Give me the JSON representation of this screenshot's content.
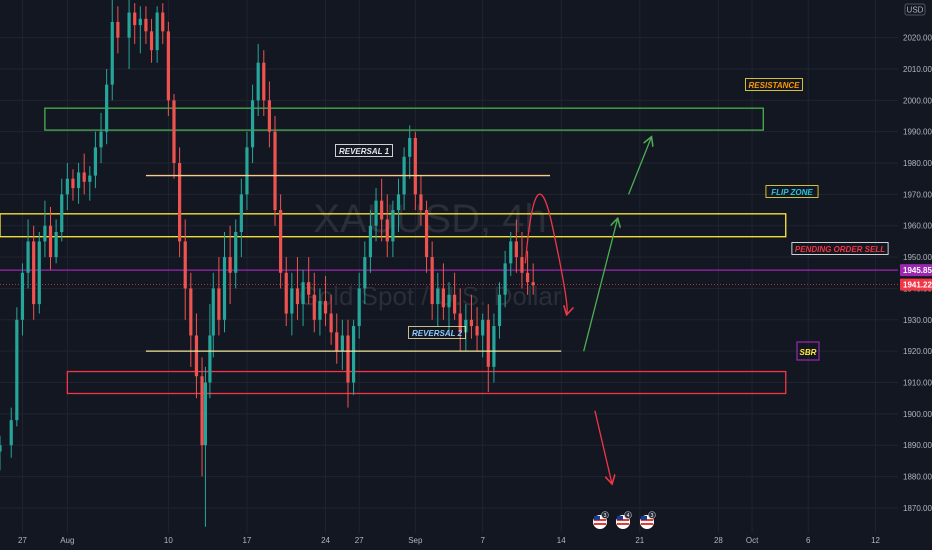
{
  "chart_data": {
    "type": "candlestick",
    "symbol_watermark": "XAUUSD, 4h",
    "symbol_watermark_sub": "Gold Spot / U.S. Dollar",
    "currency": "USD",
    "ylim": [
      1862,
      2032
    ],
    "y_ticks": [
      1870,
      1880,
      1890,
      1900,
      1910,
      1920,
      1930,
      1940,
      1950,
      1960,
      1970,
      1980,
      1990,
      2000,
      2010,
      2020
    ],
    "y_tick_labels": [
      "1870.00",
      "1880.00",
      "1890.00",
      "1900.00",
      "1910.00",
      "1920.00",
      "1930.00",
      "1940.00",
      "1950.00",
      "1960.00",
      "1970.00",
      "1980.00",
      "1990.00",
      "2000.00",
      "2010.00",
      "2020.00"
    ],
    "x_range_days": [
      -6,
      74
    ],
    "x_ticks": [
      {
        "day": -4,
        "label": "27"
      },
      {
        "day": 0,
        "label": "Aug"
      },
      {
        "day": 9,
        "label": "10"
      },
      {
        "day": 16,
        "label": "17"
      },
      {
        "day": 23,
        "label": "24"
      },
      {
        "day": 26,
        "label": "27"
      },
      {
        "day": 31,
        "label": "Sep"
      },
      {
        "day": 37,
        "label": "7"
      },
      {
        "day": 44,
        "label": "14"
      },
      {
        "day": 51,
        "label": "21"
      },
      {
        "day": 58,
        "label": "28"
      },
      {
        "day": 61,
        "label": "Oct"
      },
      {
        "day": 66,
        "label": "6"
      },
      {
        "day": 72,
        "label": "12"
      }
    ],
    "candles": [
      [
        -6,
        1888,
        1893,
        1882,
        1890
      ],
      [
        -5,
        1890,
        1902,
        1886,
        1898
      ],
      [
        -4.5,
        1898,
        1934,
        1896,
        1930
      ],
      [
        -4,
        1930,
        1948,
        1925,
        1945
      ],
      [
        -3.5,
        1945,
        1962,
        1940,
        1955
      ],
      [
        -3,
        1955,
        1960,
        1930,
        1935
      ],
      [
        -2.5,
        1935,
        1958,
        1932,
        1955
      ],
      [
        -2,
        1955,
        1968,
        1950,
        1960
      ],
      [
        -1.5,
        1960,
        1966,
        1946,
        1950
      ],
      [
        -1,
        1950,
        1962,
        1948,
        1958
      ],
      [
        -0.5,
        1958,
        1975,
        1955,
        1970
      ],
      [
        0,
        1970,
        1980,
        1965,
        1975
      ],
      [
        0.5,
        1975,
        1978,
        1968,
        1972
      ],
      [
        1,
        1972,
        1980,
        1967,
        1977
      ],
      [
        1.5,
        1977,
        1983,
        1970,
        1974
      ],
      [
        2,
        1974,
        1979,
        1968,
        1976
      ],
      [
        2.5,
        1976,
        1990,
        1972,
        1985
      ],
      [
        3,
        1985,
        1996,
        1980,
        1990
      ],
      [
        3.5,
        1990,
        2010,
        1986,
        2005
      ],
      [
        4,
        2005,
        2032,
        2000,
        2025
      ],
      [
        4.5,
        2025,
        2030,
        2015,
        2020
      ],
      [
        5.5,
        2020,
        2032,
        2010,
        2028
      ],
      [
        6,
        2028,
        2031,
        2018,
        2024
      ],
      [
        6.5,
        2024,
        2030,
        2015,
        2026
      ],
      [
        7,
        2026,
        2030,
        2018,
        2022
      ],
      [
        7.5,
        2022,
        2026,
        2012,
        2016
      ],
      [
        8,
        2016,
        2030,
        2012,
        2028
      ],
      [
        8.5,
        2028,
        2031,
        2018,
        2022
      ],
      [
        9,
        2022,
        2025,
        1995,
        2000
      ],
      [
        9.5,
        2000,
        2002,
        1975,
        1980
      ],
      [
        10,
        1980,
        1985,
        1950,
        1955
      ],
      [
        10.5,
        1955,
        1962,
        1930,
        1940
      ],
      [
        11,
        1940,
        1945,
        1915,
        1925
      ],
      [
        11.5,
        1925,
        1932,
        1905,
        1912
      ],
      [
        12,
        1912,
        1918,
        1880,
        1890
      ],
      [
        12.3,
        1890,
        1915,
        1864,
        1910
      ],
      [
        12.7,
        1910,
        1935,
        1905,
        1925
      ],
      [
        13,
        1925,
        1945,
        1918,
        1940
      ],
      [
        13.5,
        1940,
        1950,
        1925,
        1930
      ],
      [
        14,
        1930,
        1958,
        1926,
        1950
      ],
      [
        14.5,
        1950,
        1960,
        1935,
        1945
      ],
      [
        15,
        1945,
        1962,
        1940,
        1958
      ],
      [
        15.5,
        1958,
        1975,
        1950,
        1970
      ],
      [
        16,
        1970,
        1990,
        1965,
        1985
      ],
      [
        16.5,
        1985,
        2005,
        1980,
        2000
      ],
      [
        17,
        2000,
        2018,
        1995,
        2012
      ],
      [
        17.5,
        2012,
        2016,
        1995,
        2000
      ],
      [
        18,
        2000,
        2006,
        1985,
        1990
      ],
      [
        18.5,
        1990,
        1995,
        1960,
        1965
      ],
      [
        19,
        1965,
        1970,
        1940,
        1945
      ],
      [
        19.5,
        1945,
        1950,
        1928,
        1932
      ],
      [
        20,
        1932,
        1945,
        1925,
        1940
      ],
      [
        20.5,
        1940,
        1950,
        1930,
        1935
      ],
      [
        21,
        1935,
        1946,
        1928,
        1942
      ],
      [
        21.5,
        1942,
        1950,
        1935,
        1938
      ],
      [
        22,
        1938,
        1945,
        1926,
        1930
      ],
      [
        22.5,
        1930,
        1940,
        1925,
        1936
      ],
      [
        23,
        1936,
        1944,
        1928,
        1932
      ],
      [
        23.5,
        1932,
        1938,
        1922,
        1926
      ],
      [
        24,
        1926,
        1932,
        1916,
        1920
      ],
      [
        24.5,
        1920,
        1930,
        1914,
        1925
      ],
      [
        25,
        1925,
        1930,
        1902,
        1910
      ],
      [
        25.5,
        1910,
        1930,
        1906,
        1928
      ],
      [
        26,
        1928,
        1945,
        1924,
        1940
      ],
      [
        26.5,
        1940,
        1955,
        1935,
        1950
      ],
      [
        27,
        1950,
        1965,
        1945,
        1960
      ],
      [
        27.5,
        1960,
        1972,
        1955,
        1968
      ],
      [
        28,
        1968,
        1975,
        1955,
        1962
      ],
      [
        28.5,
        1962,
        1970,
        1950,
        1955
      ],
      [
        29,
        1955,
        1968,
        1950,
        1965
      ],
      [
        29.5,
        1965,
        1975,
        1958,
        1970
      ],
      [
        30,
        1970,
        1985,
        1965,
        1982
      ],
      [
        30.5,
        1982,
        1992,
        1975,
        1988
      ],
      [
        31,
        1988,
        1990,
        1965,
        1970
      ],
      [
        31.5,
        1970,
        1976,
        1960,
        1965
      ],
      [
        32,
        1965,
        1968,
        1945,
        1950
      ],
      [
        32.5,
        1950,
        1955,
        1930,
        1935
      ],
      [
        33,
        1935,
        1945,
        1928,
        1940
      ],
      [
        33.5,
        1940,
        1948,
        1930,
        1934
      ],
      [
        34,
        1934,
        1942,
        1925,
        1938
      ],
      [
        34.5,
        1938,
        1945,
        1930,
        1932
      ],
      [
        35,
        1932,
        1940,
        1920,
        1926
      ],
      [
        35.5,
        1926,
        1935,
        1920,
        1930
      ],
      [
        36,
        1930,
        1938,
        1924,
        1928
      ],
      [
        36.5,
        1928,
        1934,
        1920,
        1925
      ],
      [
        37,
        1925,
        1932,
        1918,
        1930
      ],
      [
        37.5,
        1930,
        1935,
        1907,
        1915
      ],
      [
        38,
        1915,
        1932,
        1910,
        1928
      ],
      [
        38.5,
        1928,
        1942,
        1924,
        1938
      ],
      [
        39,
        1938,
        1952,
        1934,
        1948
      ],
      [
        39.5,
        1948,
        1958,
        1944,
        1955
      ],
      [
        40,
        1955,
        1962,
        1945,
        1950
      ],
      [
        40.5,
        1950,
        1958,
        1940,
        1945
      ],
      [
        41,
        1945,
        1952,
        1938,
        1942
      ],
      [
        41.5,
        1942,
        1948,
        1938,
        1941
      ]
    ],
    "current_price": {
      "value": 1941.22,
      "label": "1941.22"
    },
    "pending_price": {
      "value": 1945.85,
      "label": "1945.85"
    },
    "annotations": {
      "resistance": {
        "label": "RESISTANCE",
        "zone": [
          1990.5,
          1997.5
        ],
        "day_range": [
          -2,
          62
        ],
        "color": "#4caf50"
      },
      "flip_zone": {
        "label": "FLIP ZONE",
        "zone": [
          1956.5,
          1963.8
        ],
        "day_range": [
          -6,
          64
        ],
        "color": "#ffeb3b"
      },
      "support": {
        "label": "SBR",
        "zone": [
          1906.5,
          1913.5
        ],
        "day_range": [
          0,
          64
        ],
        "color": "#f23645"
      },
      "reversal_1": {
        "label": "REVERSAL 1",
        "value": 1976,
        "day_range": [
          7,
          43
        ],
        "color": "#fbc98c"
      },
      "reversal_2": {
        "label": "REVERSAL 2",
        "value": 1920,
        "day_range": [
          7,
          44
        ],
        "color": "#f5e6a0"
      },
      "pending_order": {
        "label": "PENDING ORDER SELL",
        "color": "#9c27b0",
        "text_color": "#f23645"
      },
      "arrow_green_1": {
        "from": [
          46,
          1920
        ],
        "to": [
          49,
          1962
        ],
        "color": "#4caf50"
      },
      "arrow_green_2": {
        "from": [
          50,
          1970
        ],
        "to": [
          52,
          1988
        ],
        "color": "#4caf50"
      },
      "arrow_red_1": {
        "from": [
          47,
          1901
        ],
        "to": [
          48.5,
          1878
        ],
        "color": "#f23645"
      },
      "arrow_red_curve": {
        "color": "#f23645"
      }
    },
    "colors": {
      "up": "#26a69a",
      "down": "#ef5350",
      "background": "#131722",
      "grid": "#1f2430",
      "pending_line": "#9c27b0",
      "current_tag": "#f23645",
      "pending_tag": "#9c27b0"
    },
    "event_icons": [
      "flag-us-icon",
      "flag-us-icon",
      "flag-us-icon"
    ],
    "event_icon_counts": [
      "3",
      "4",
      "3"
    ]
  }
}
